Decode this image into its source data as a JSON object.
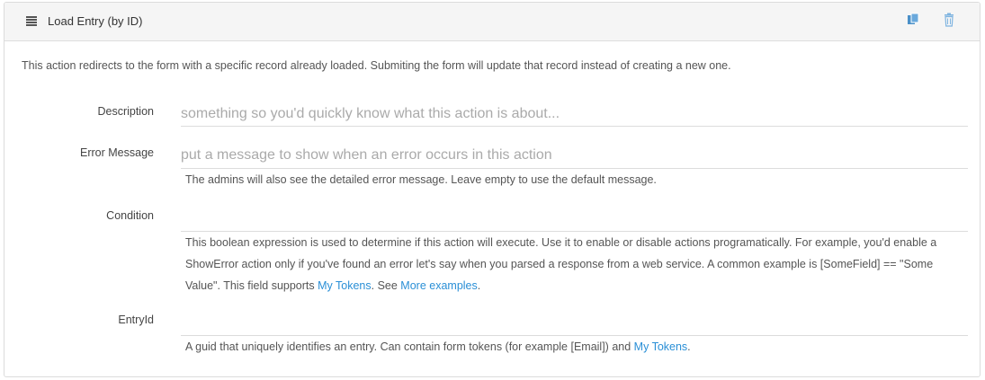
{
  "header": {
    "title": "Load Entry (by ID)",
    "menu_icon": "hamburger-icon",
    "copy_icon": "copy-icon",
    "delete_icon": "trash-icon"
  },
  "intro": "This action redirects to the form with a specific record already loaded. Submiting the form will update that record instead of creating a new one.",
  "fields": {
    "description": {
      "label": "Description",
      "placeholder": "something so you'd quickly know what this action is about...",
      "value": ""
    },
    "error_message": {
      "label": "Error Message",
      "placeholder": "put a message to show when an error occurs in this action",
      "value": "",
      "help": "The admins will also see the detailed error message. Leave empty to use the default message."
    },
    "condition": {
      "label": "Condition",
      "value": "",
      "help_text": "This boolean expression is used to determine if this action will execute. Use it to enable or disable actions programatically. For example, you'd enable a ShowError action only if you've found an error let's say when you parsed a response from a web service. A common example is [SomeField] == \"Some Value\". This field supports ",
      "help_link1": "My Tokens",
      "help_mid": ". See ",
      "help_link2": "More examples",
      "help_end": "."
    },
    "entry_id": {
      "label": "EntryId",
      "value": "",
      "help_text": "A guid that uniquely identifies an entry. Can contain form tokens (for example [Email]) and ",
      "help_link": "My Tokens",
      "help_end": "."
    }
  },
  "colors": {
    "link": "#2a8fd6",
    "header_bg": "#f5f5f5",
    "icon": "#4a90c8"
  }
}
